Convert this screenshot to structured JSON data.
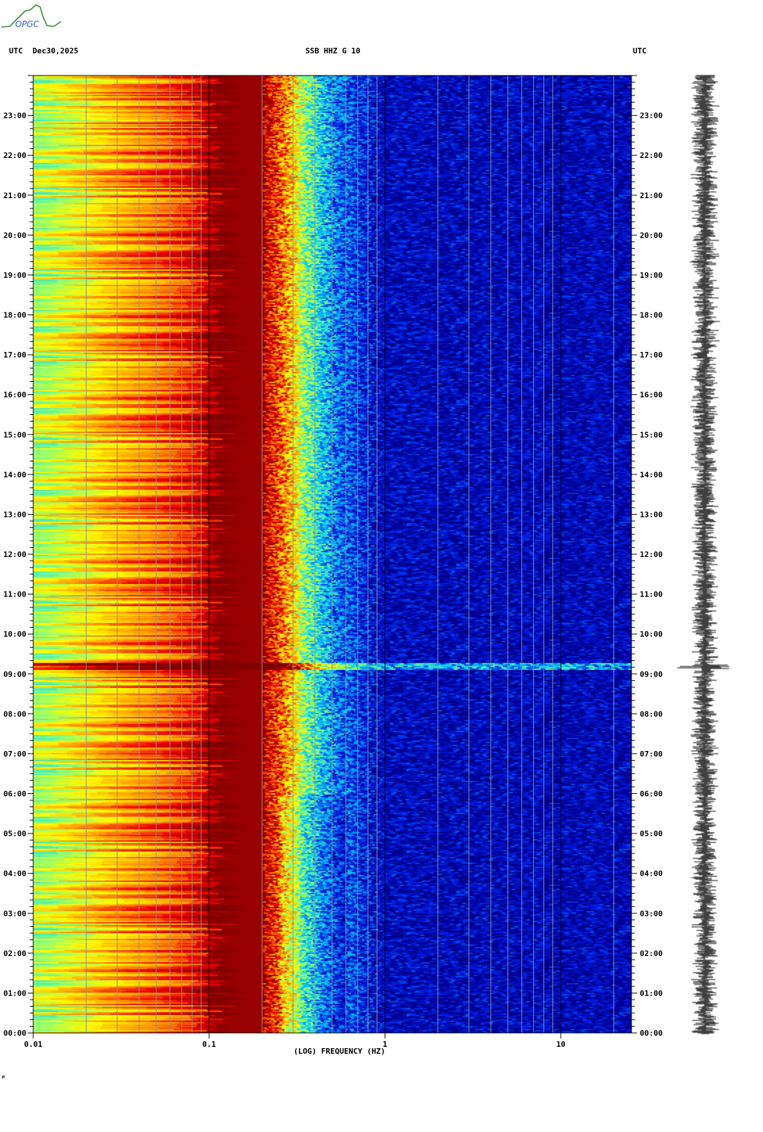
{
  "logo": {
    "text": "OPGC"
  },
  "header": {
    "left_label": "UTC",
    "date": "Dec30,2025",
    "title": "SSB HHZ G 10",
    "right_label": "UTC"
  },
  "footer_mark": "M",
  "colors": {
    "low": "#00008c",
    "high": "#800000",
    "grid": "#909090"
  },
  "chart_data": {
    "type": "heatmap",
    "title": "SSB HHZ G 10",
    "xlabel": "(LOG) FREQUENCY (HZ)",
    "ylabel": "UTC",
    "xscale": "log",
    "xlim": [
      0.01,
      25
    ],
    "ylim_hours": [
      0,
      24
    ],
    "x_tick_labels": [
      "0.01",
      "0.1",
      "1",
      "10"
    ],
    "x_tick_values": [
      0.01,
      0.1,
      1,
      10
    ],
    "y_tick_labels": [
      "00:00",
      "01:00",
      "02:00",
      "03:00",
      "04:00",
      "05:00",
      "06:00",
      "07:00",
      "08:00",
      "09:00",
      "10:00",
      "11:00",
      "12:00",
      "13:00",
      "14:00",
      "15:00",
      "16:00",
      "17:00",
      "18:00",
      "19:00",
      "20:00",
      "21:00",
      "22:00",
      "23:00"
    ],
    "grid_frequencies": [
      0.02,
      0.03,
      0.04,
      0.05,
      0.06,
      0.07,
      0.08,
      0.09,
      0.2,
      0.3,
      0.4,
      0.5,
      0.6,
      0.7,
      0.8,
      0.9,
      2,
      3,
      4,
      5,
      6,
      7,
      8,
      9,
      20
    ],
    "relative_power_profile": {
      "frequency_hz": [
        0.01,
        0.025,
        0.05,
        0.075,
        0.1,
        0.2,
        0.27,
        0.35,
        0.5,
        0.8,
        1.0,
        25
      ],
      "level": [
        0.55,
        0.7,
        0.78,
        0.86,
        1.0,
        0.93,
        0.75,
        0.5,
        0.28,
        0.15,
        0.08,
        0.07
      ]
    },
    "event_hour": 9.2
  }
}
